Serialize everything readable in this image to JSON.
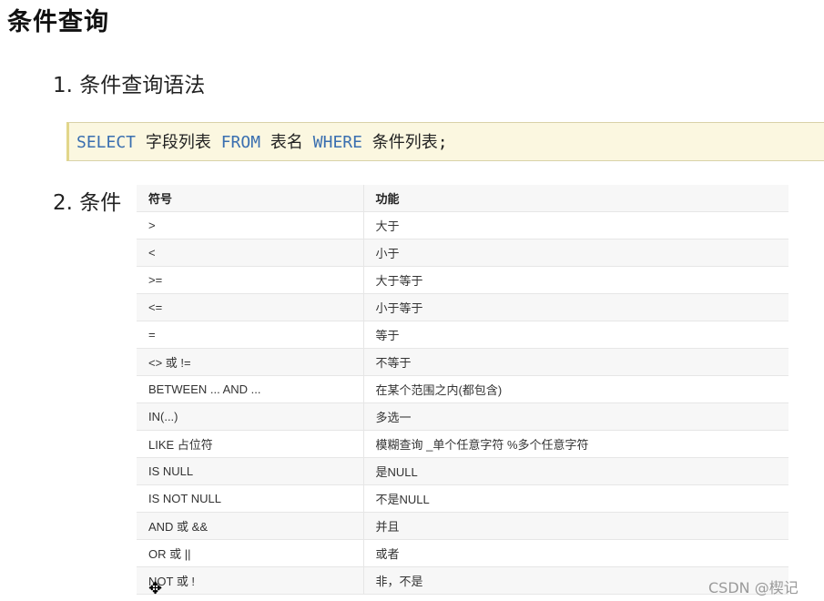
{
  "page_title": "条件查询",
  "section1": {
    "label": "1. 条件查询语法"
  },
  "code": {
    "kw_select": "SELECT",
    "t1": "字段列表",
    "kw_from": "FROM",
    "t2": "表名",
    "kw_where": "WHERE",
    "t3": "条件列表;"
  },
  "section2": {
    "label": "2. 条件"
  },
  "table": {
    "headers": [
      "符号",
      "功能"
    ],
    "rows": [
      [
        ">",
        "大于"
      ],
      [
        "<",
        "小于"
      ],
      [
        ">=",
        "大于等于"
      ],
      [
        "<=",
        "小于等于"
      ],
      [
        "=",
        "等于"
      ],
      [
        "<> 或 !=",
        "不等于"
      ],
      [
        "BETWEEN ... AND ...",
        "在某个范围之内(都包含)"
      ],
      [
        "IN(...)",
        "多选一"
      ],
      [
        "LIKE 占位符",
        "模糊查询 _单个任意字符 %多个任意字符"
      ],
      [
        "IS NULL",
        "是NULL"
      ],
      [
        "IS NOT NULL",
        "不是NULL"
      ],
      [
        "AND 或 &&",
        "并且"
      ],
      [
        "OR 或 ||",
        "或者"
      ],
      [
        "NOT 或 !",
        "非，不是"
      ]
    ]
  },
  "watermark": "CSDN @楔记",
  "icons": {
    "cursor": "move-cursor-icon"
  }
}
